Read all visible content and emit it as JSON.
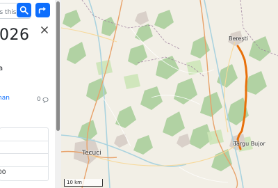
{
  "sidebar": {
    "search": {
      "placeholder": "is this?"
    },
    "title": "026",
    "description_fragment": "a",
    "link_fragment": "nan",
    "comment_count": "0",
    "table_value": "00"
  },
  "map": {
    "places": {
      "beresti": "Berești",
      "targu_bujor": "Târgu Bujor",
      "tecuci": "Tecuci"
    },
    "scale_label": "10 km",
    "route_color": "#e8700a"
  }
}
